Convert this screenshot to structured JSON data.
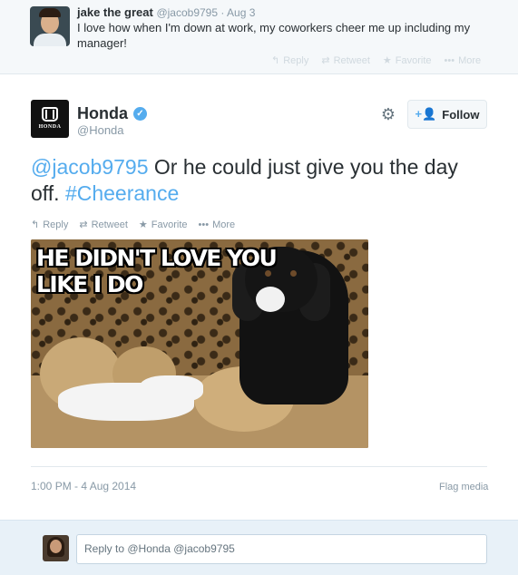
{
  "parent_tweet": {
    "name": "jake the great",
    "handle": "@jacob9795",
    "date": "Aug 3",
    "text": "I love how when I'm down at work, my coworkers cheer me up including my manager!",
    "actions": {
      "reply": "Reply",
      "retweet": "Retweet",
      "favorite": "Favorite",
      "more": "More"
    }
  },
  "main_tweet": {
    "name": "Honda",
    "handle": "@Honda",
    "logo_text": "HONDA",
    "follow_label": "Follow",
    "text_mention": "@jacob9795",
    "text_body": " Or he could just give you the day off. ",
    "text_hashtag": "#Cheerance",
    "actions": {
      "reply": "Reply",
      "retweet": "Retweet",
      "favorite": "Favorite",
      "more": "More"
    },
    "media": {
      "caption_line1": "HE DIDN'T LOVE YOU",
      "caption_line2": "LIKE I DO"
    },
    "timestamp": "1:00 PM - 4 Aug 2014",
    "flag_label": "Flag media"
  },
  "reply_box": {
    "value": "Reply to @Honda @jacob9795"
  },
  "colors": {
    "link": "#55acee",
    "muted": "#8899a6",
    "text": "#292f33",
    "reply_bg": "#e8f1f8"
  },
  "icons": [
    "reply-icon",
    "retweet-icon",
    "favorite-icon",
    "more-icon",
    "gear-icon",
    "verified-icon",
    "follow-user-icon"
  ]
}
